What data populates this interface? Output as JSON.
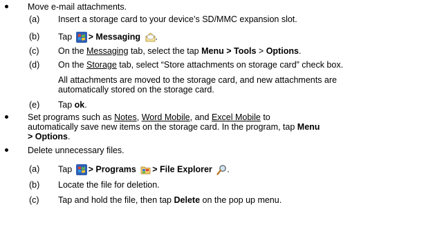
{
  "items": [
    {
      "bullet": "Move e-mail attachments.",
      "steps": [
        {
          "label": "(a)",
          "text": "Insert a storage card to your device’s SD/MMC expansion slot."
        },
        {
          "label": "(b)",
          "tap": "Tap",
          "gt_messaging": "> Messaging"
        },
        {
          "label": "(c)",
          "pre": "On the",
          "tab": "Messaging",
          "mid": "tab, select the tap",
          "menu": "Menu > Tools",
          "gt": ">",
          "options": "Options",
          "end": "."
        },
        {
          "label": "(d)",
          "pre": "On the",
          "tab": "Storage",
          "rest": "tab, select “Store attachments on storage card” check box."
        },
        {
          "note1": "All attachments are moved to the storage card, and new attachments are",
          "note2": "automatically stored on the storage card."
        },
        {
          "label": "(e)",
          "tap": "Tap",
          "ok": "ok",
          "end": "."
        }
      ]
    },
    {
      "line1_pre": "Set programs such as",
      "notes": "Notes",
      "word": "Word Mobile",
      "and": "and",
      "excel": "Excel Mobile",
      "to": "to",
      "line2": "automatically save new items on the storage card. In the program, tap",
      "menu": "Menu",
      "options": "> Options",
      "period": "."
    },
    {
      "bullet": "Delete unnecessary files.",
      "steps": [
        {
          "label": "(a)",
          "tap": "Tap",
          "programs": "> Programs",
          "fe": "> File Explorer",
          "end": "."
        },
        {
          "label": "(b)",
          "text": "Locate the file for deletion."
        },
        {
          "label": "(c)",
          "pre": "Tap and hold the file, then tap",
          "delete": "Delete",
          "post": "on the pop up menu."
        }
      ]
    }
  ],
  "icons": {
    "start": "windows-start-icon",
    "messaging": "messaging-envelope-icon",
    "programs": "programs-folder-icon",
    "file_explorer": "file-explorer-icon"
  }
}
